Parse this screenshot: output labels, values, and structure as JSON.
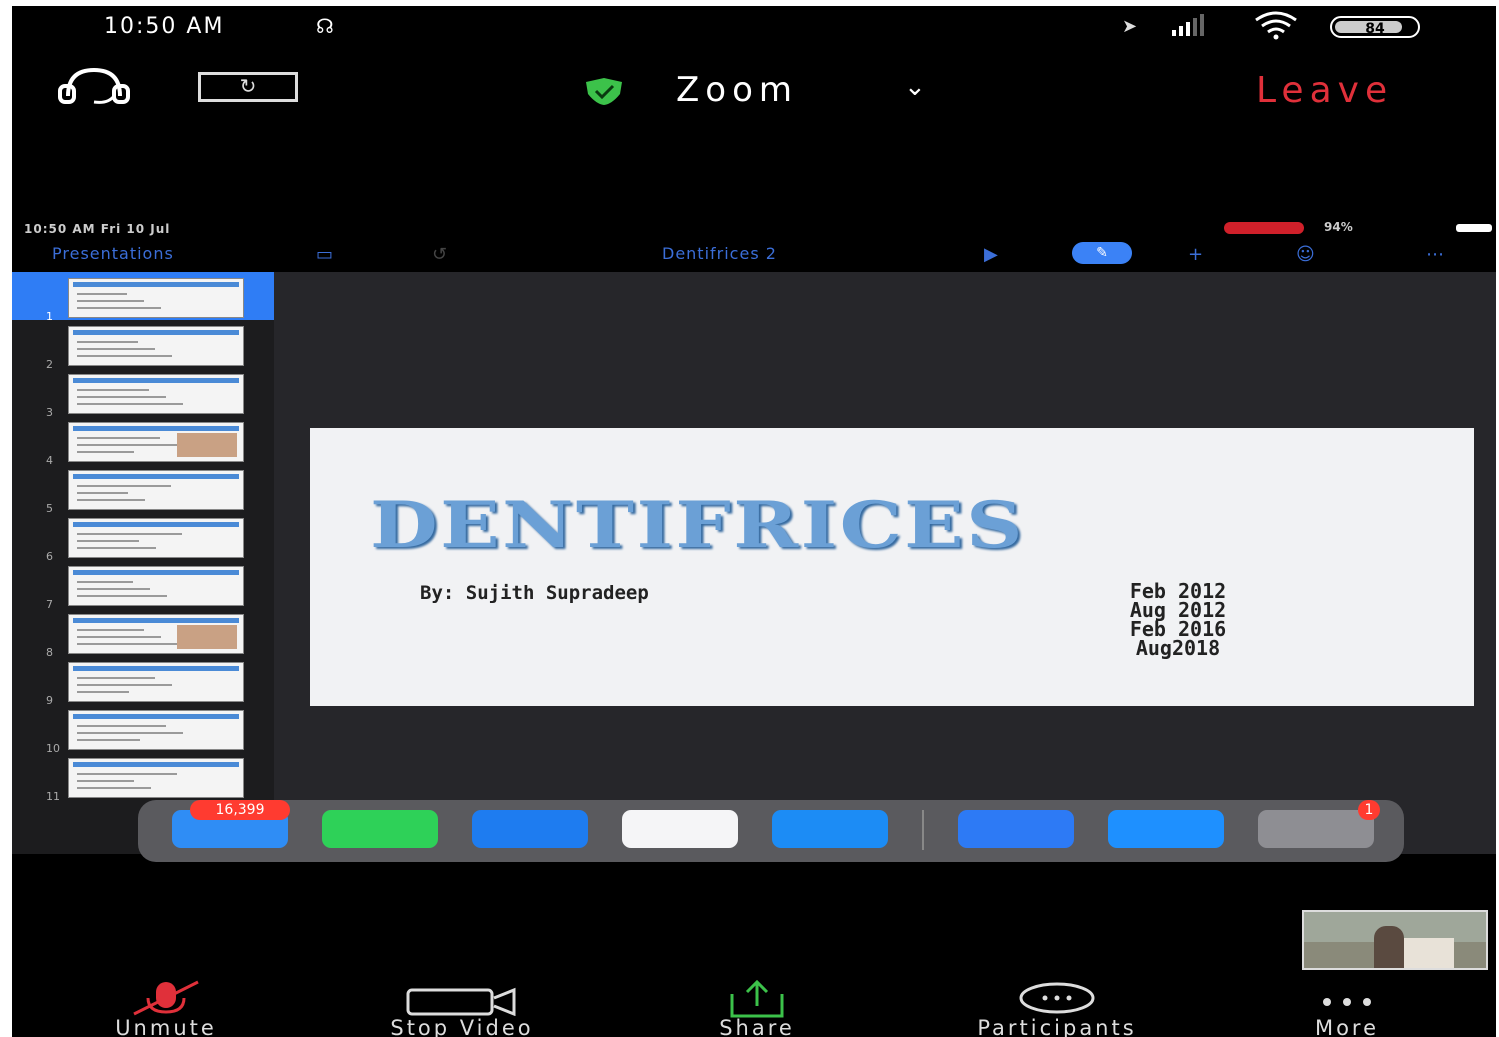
{
  "status_bar": {
    "time": "10:50 AM",
    "battery": "84",
    "battery_level": 0.84
  },
  "meeting_header": {
    "title": "Zoom",
    "leave_label": "Leave",
    "shield_color": "#3cc24a",
    "leave_color": "#e0303a"
  },
  "shared_screen": {
    "status_time": "10:50 AM   Fri 10 Jul",
    "status_right": "94%",
    "back_label": "Presentations",
    "document_title": "Dentifrices 2",
    "accent": "#3b6ed8",
    "slides": [
      {
        "number": "1"
      },
      {
        "number": "2"
      },
      {
        "number": "3"
      },
      {
        "number": "4"
      },
      {
        "number": "5"
      },
      {
        "number": "6"
      },
      {
        "number": "7"
      },
      {
        "number": "8"
      },
      {
        "number": "9"
      },
      {
        "number": "10"
      },
      {
        "number": "11"
      }
    ],
    "current_slide": {
      "title": "DENTIFRICES",
      "author": "By: Sujith Supradeep",
      "dates": [
        "Feb 2012",
        "Aug 2012",
        "Feb 2016",
        "Aug2018"
      ]
    }
  },
  "dock": {
    "apps": [
      {
        "name": "mail-app",
        "color": "#2f8df5",
        "badge": "16,399"
      },
      {
        "name": "messages-app",
        "color": "#2ed158",
        "badge": ""
      },
      {
        "name": "safari-app",
        "color": "#1e7cf0",
        "badge": ""
      },
      {
        "name": "music-app",
        "color": "#f5f5f7",
        "badge": ""
      },
      {
        "name": "files-app",
        "color": "#1c8cf5",
        "badge": ""
      },
      {
        "name": "zoom-app",
        "color": "#2d7af5",
        "badge": ""
      },
      {
        "name": "keynote-app",
        "color": "#1e90ff",
        "badge": ""
      },
      {
        "name": "settings-app",
        "color": "#8e8e93",
        "badge": "1"
      }
    ]
  },
  "toolbar": {
    "unmute_label": "Unmute",
    "stop_video_label": "Stop Video",
    "share_label": "Share",
    "participants_label": "Participants",
    "more_label": "More",
    "mute_color": "#e0303a",
    "share_color": "#3cc24a"
  }
}
